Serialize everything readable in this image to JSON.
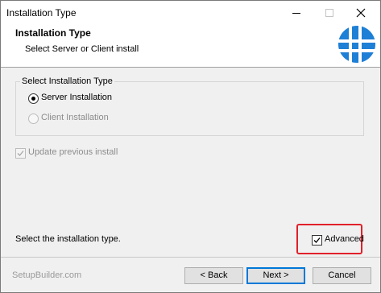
{
  "window": {
    "title": "Installation Type"
  },
  "header": {
    "title": "Installation Type",
    "subtitle": "Select Server or Client install"
  },
  "group": {
    "label": "Select Installation Type",
    "options": [
      {
        "label": "Server Installation",
        "selected": true,
        "enabled": true
      },
      {
        "label": "Client Installation",
        "selected": false,
        "enabled": false
      }
    ]
  },
  "update_checkbox": {
    "label": "Update previous install",
    "checked": true,
    "enabled": false
  },
  "status": {
    "text": "Select the installation type."
  },
  "advanced_checkbox": {
    "label": "Advanced",
    "checked": true,
    "highlight_color": "#e0202a"
  },
  "footer": {
    "brand": "SetupBuilder.com",
    "back_label": "< Back",
    "next_label": "Next >",
    "cancel_label": "Cancel"
  },
  "colors": {
    "logo": "#1e7fd6",
    "accent": "#0078d7"
  },
  "icons": [
    "minimize-icon",
    "maximize-icon",
    "close-icon",
    "setup-logo-icon",
    "checkmark-icon"
  ]
}
